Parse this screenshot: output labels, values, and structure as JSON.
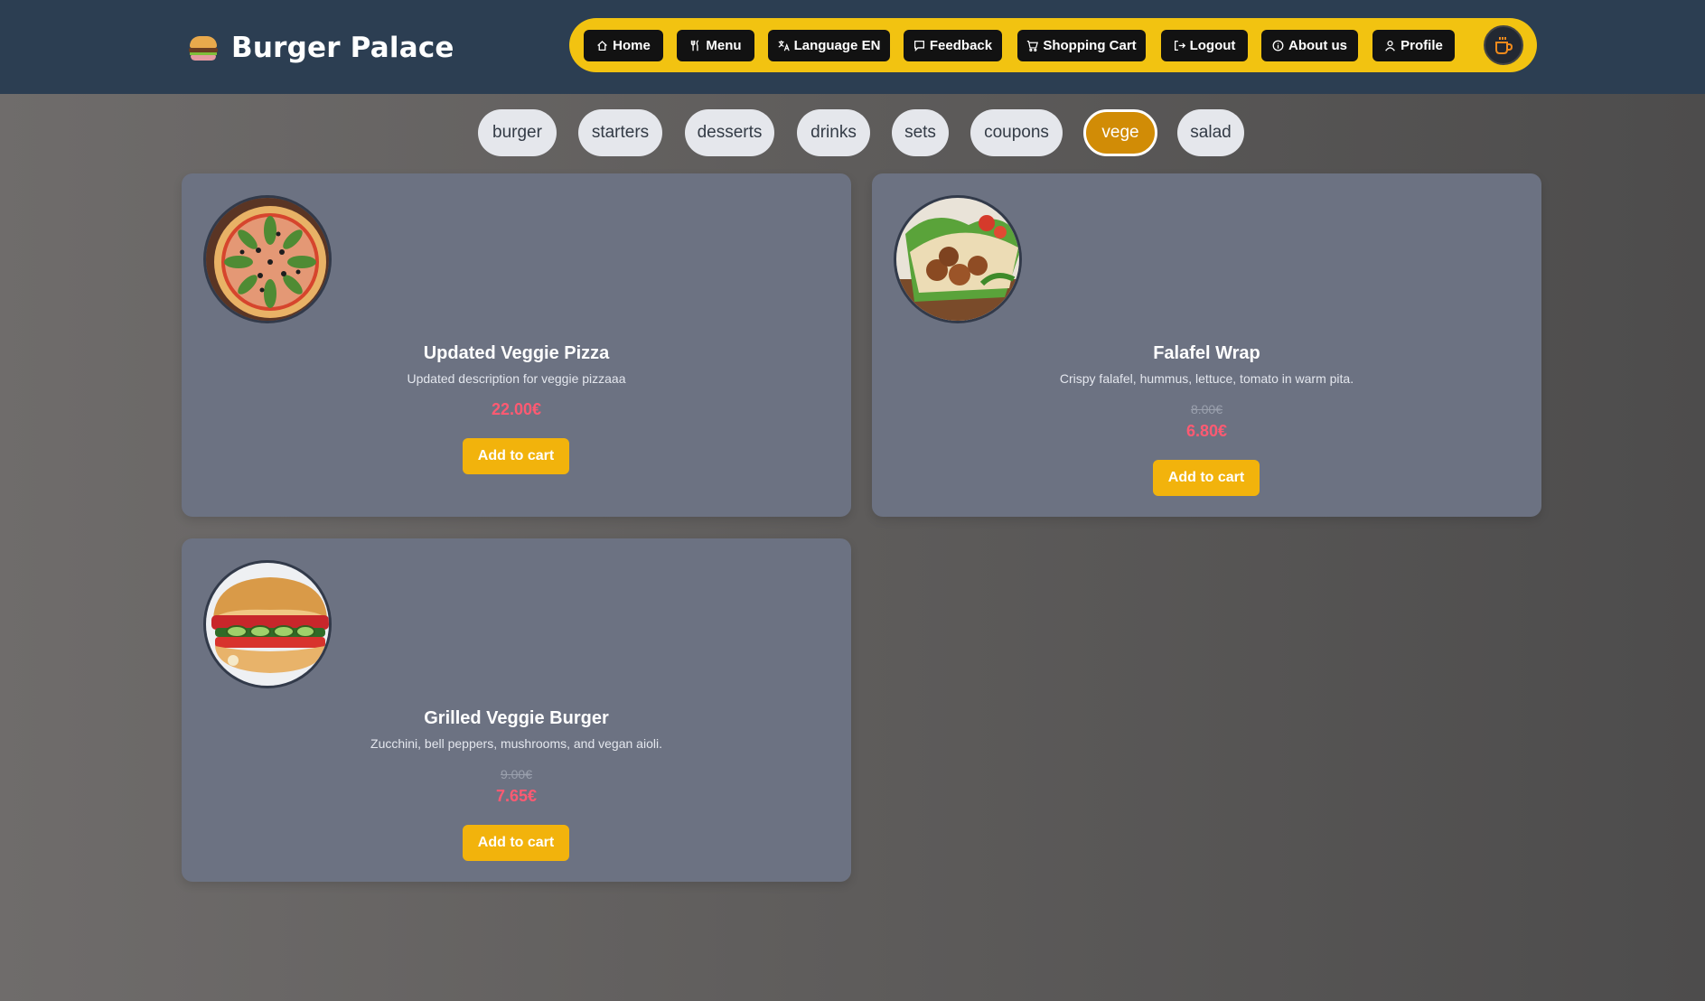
{
  "brand": {
    "title": "Burger Palace",
    "icon": "burger-icon"
  },
  "nav": {
    "items": [
      {
        "label": "Home",
        "icon": "home-icon"
      },
      {
        "label": "Menu",
        "icon": "utensils-icon"
      },
      {
        "label": "Language EN",
        "icon": "translate-icon"
      },
      {
        "label": "Feedback",
        "icon": "message-icon"
      },
      {
        "label": "Shopping Cart",
        "icon": "cart-icon"
      },
      {
        "label": "Logout",
        "icon": "logout-icon"
      },
      {
        "label": "About us",
        "icon": "info-icon"
      },
      {
        "label": "Profile",
        "icon": "user-icon"
      }
    ],
    "theme_toggle_icon": "coffee-cup-icon"
  },
  "categories": {
    "items": [
      "burger",
      "starters",
      "desserts",
      "drinks",
      "sets",
      "coupons",
      "vege",
      "salad"
    ],
    "active": "vege"
  },
  "products": [
    {
      "name": "Updated Veggie Pizza",
      "description": "Updated description for veggie pizzaaa",
      "old_price": "",
      "price": "22.00€",
      "button": "Add to cart",
      "image": "veggie-pizza-image"
    },
    {
      "name": "Falafel Wrap",
      "description": "Crispy falafel, hummus, lettuce, tomato in warm pita.",
      "old_price": "8.00€",
      "price": "6.80€",
      "button": "Add to cart",
      "image": "falafel-wrap-image"
    },
    {
      "name": "Grilled Veggie Burger",
      "description": "Zucchini, bell peppers, mushrooms, and vegan aioli.",
      "old_price": "9.00€",
      "price": "7.65€",
      "button": "Add to cart",
      "image": "veggie-burger-image"
    }
  ],
  "colors": {
    "header_bg": "#2c3e52",
    "nav_pill": "#f2c311",
    "accent_button": "#f2b30c",
    "active_chip": "#d18c06",
    "price": "#ff5a72",
    "card_bg": "#6c7282"
  }
}
